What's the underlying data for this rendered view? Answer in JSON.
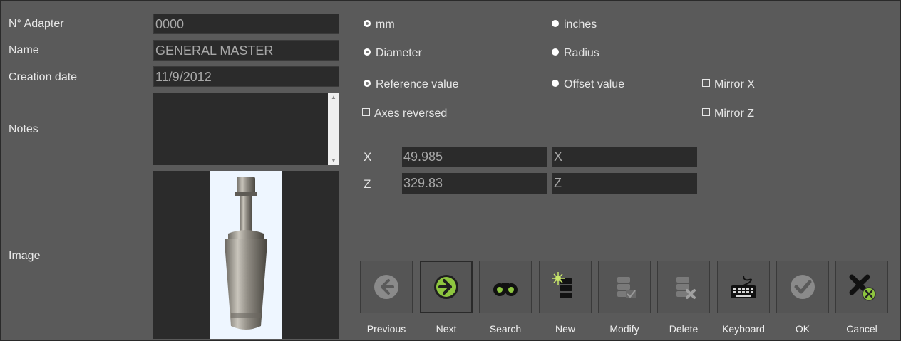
{
  "form": {
    "adapter_label": "N° Adapter",
    "adapter_value": "0000",
    "name_label": "Name",
    "name_value": "GENERAL MASTER",
    "date_label": "Creation date",
    "date_value": "11/9/2012",
    "notes_label": "Notes",
    "notes_value": "",
    "image_label": "Image"
  },
  "options": {
    "mm": "mm",
    "inches": "inches",
    "diameter": "Diameter",
    "radius": "Radius",
    "reference": "Reference value",
    "offset": "Offset value",
    "mirror_x": "Mirror X",
    "mirror_z": "Mirror Z",
    "axes_reversed": "Axes reversed"
  },
  "axes": {
    "x_label": "X",
    "x_value": "49.985",
    "x_offset": "X",
    "z_label": "Z",
    "z_value": "329.83",
    "z_offset": "Z"
  },
  "buttons": {
    "previous": "Previous",
    "next": "Next",
    "search": "Search",
    "new": "New",
    "modify": "Modify",
    "delete": "Delete",
    "keyboard": "Keyboard",
    "ok": "OK",
    "cancel": "Cancel"
  },
  "icons": [
    "arrow-left-icon",
    "arrow-right-icon",
    "binoculars-icon",
    "new-record-icon",
    "modify-record-icon",
    "delete-record-icon",
    "keyboard-icon",
    "check-icon",
    "cancel-icon"
  ],
  "colors": {
    "accent_green": "#8ec63f",
    "panel": "#5a5a5a",
    "field": "#2b2b2b"
  }
}
